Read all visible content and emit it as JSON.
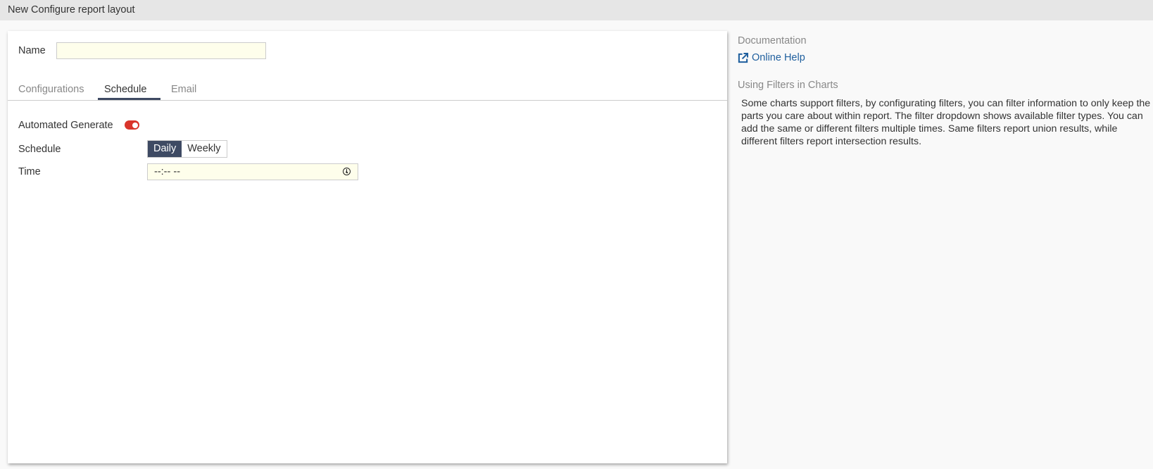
{
  "window": {
    "title": "New Configure report layout"
  },
  "form": {
    "name_label": "Name",
    "name_value": "",
    "name_placeholder": "",
    "tabs": [
      {
        "label": "Configurations"
      },
      {
        "label": "Schedule"
      },
      {
        "label": "Email"
      }
    ],
    "active_tab": "Schedule",
    "automated_label": "Automated Generate",
    "automated_on": true,
    "schedule_label": "Schedule",
    "schedule_options": [
      "Daily",
      "Weekly"
    ],
    "schedule_selected": "Daily",
    "time_label": "Time",
    "time_value": "--:-- --"
  },
  "sidebar": {
    "doc_heading": "Documentation",
    "help_link": "Online Help",
    "filters_heading": "Using Filters in Charts",
    "filters_text": "Some charts support filters, by configurating filters, you can filter information to only keep the parts you care about within report. The filter dropdown shows available filter types. You can add the same or different filters multiple times. Same filters report union results, while different filters report intersection results."
  },
  "colors": {
    "accent": "#3e4a63",
    "toggle": "#d9352b",
    "link": "#1f5f9e",
    "input_bg": "#fefeeb"
  }
}
